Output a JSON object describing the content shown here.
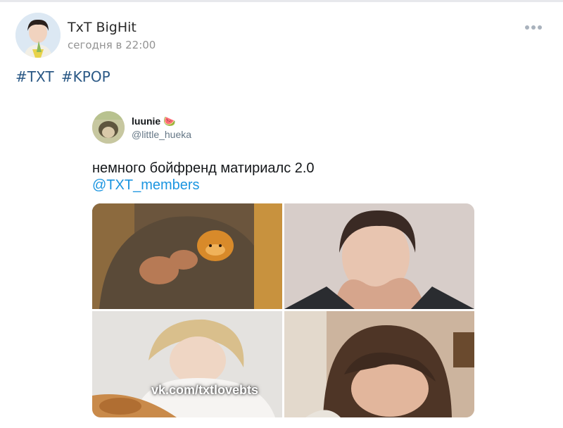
{
  "post": {
    "author": "TxT BigHit",
    "time": "сегодня в 22:00",
    "hashtags": [
      "#TXT",
      "#KPOP"
    ]
  },
  "tweet": {
    "name": "luunie",
    "emoji": "🍉",
    "handle": "@little_hueka",
    "text": "немного бойфренд матириалс 2.0",
    "mention": "@TXT_members"
  },
  "photos": {
    "watermark": "vk.com/txtlovebts"
  },
  "icons": {
    "more": "more-horizontal-icon"
  },
  "colors": {
    "link": "#2a5885",
    "mention": "#1b95e0"
  }
}
